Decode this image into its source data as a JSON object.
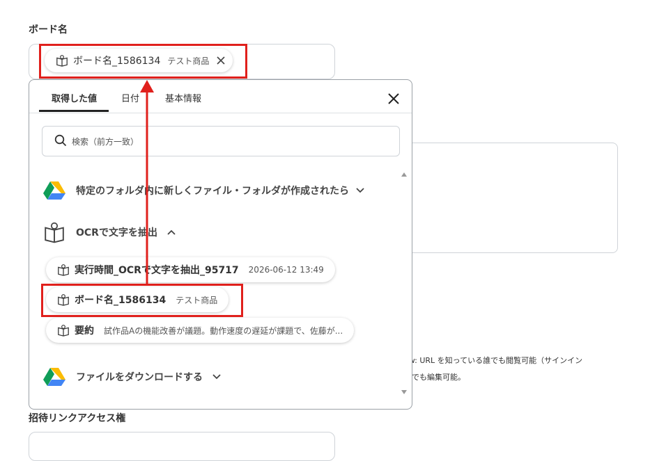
{
  "board_name": {
    "label": "ボード名",
    "chip": {
      "title": "ボード名_1586134",
      "sub": "テスト商品"
    }
  },
  "picker": {
    "tabs": [
      "取得した値",
      "日付",
      "基本情報"
    ],
    "search_placeholder": "検索（前方一致）",
    "sections": [
      {
        "title": "特定のフォルダ内に新しくファイル・フォルダが作成されたら",
        "icon": "google-drive-icon"
      },
      {
        "title": "OCRで文字を抽出",
        "icon": "ocr-book-icon"
      },
      {
        "title": "ファイルをダウンロードする",
        "icon": "google-drive-icon"
      }
    ],
    "items": [
      {
        "title": "実行時間_OCRで文字を抽出_95717",
        "sub": "2026-06-12 13:49"
      },
      {
        "title": "ボード名_1586134",
        "sub": "テスト商品"
      },
      {
        "title": "要約",
        "sub": "試作品Aの機能改善が議題。動作速度の遅延が課題で、佐藤が..."
      }
    ]
  },
  "background_text": {
    "line1": "ew: URL を知っている誰でも閲覧可能（サインイン",
    "line2": "誰でも編集可能。"
  },
  "invite": {
    "label": "招待リンクアクセス権"
  },
  "colors": {
    "highlight": "#e0201c",
    "tab_underline": "#222222"
  }
}
